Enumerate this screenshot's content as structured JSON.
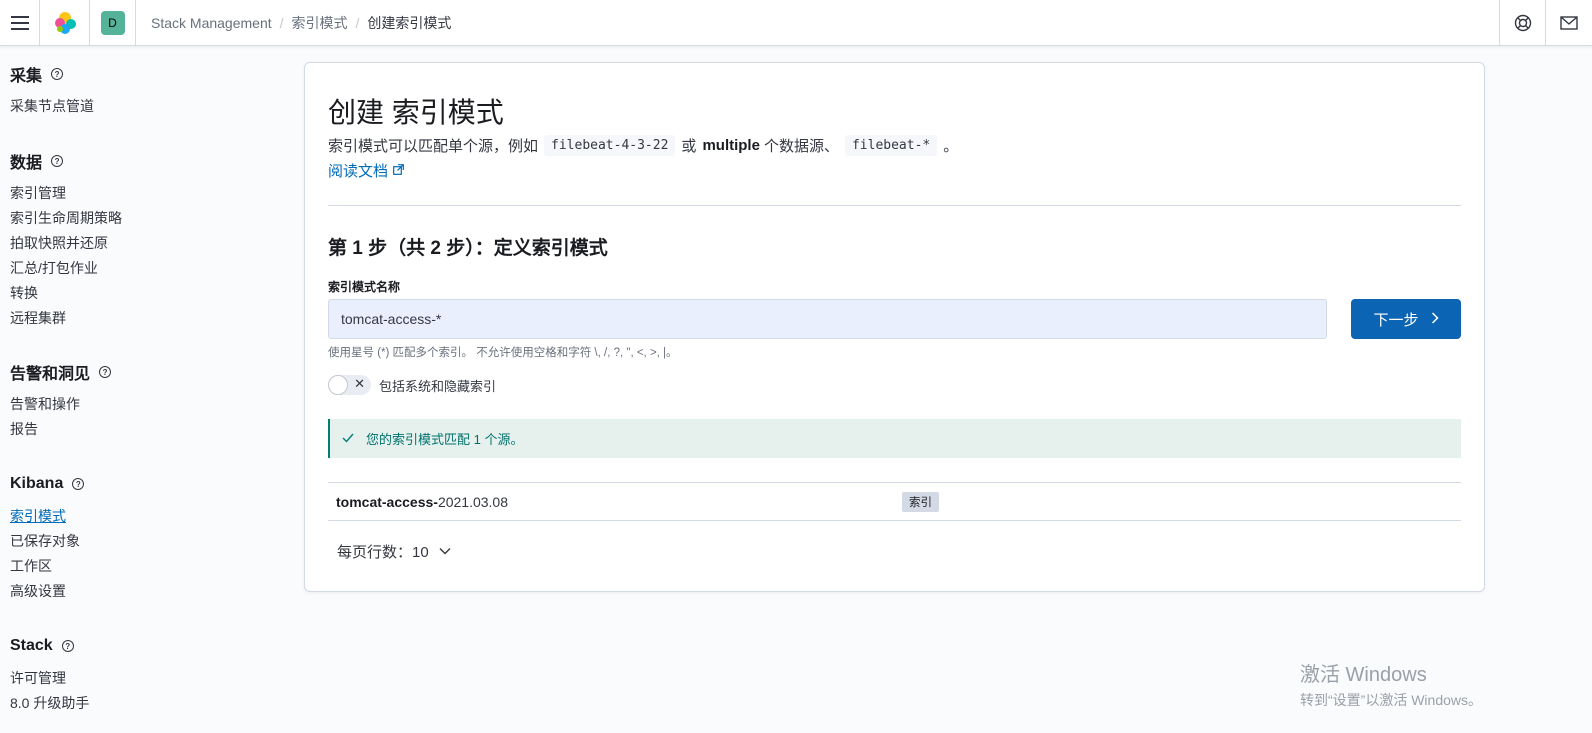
{
  "header": {
    "space_initial": "D",
    "breadcrumbs": [
      "Stack Management",
      "索引模式",
      "创建索引模式"
    ]
  },
  "sidebar": {
    "groups": [
      {
        "title": "采集",
        "items": [
          "采集节点管道"
        ]
      },
      {
        "title": "数据",
        "items": [
          "索引管理",
          "索引生命周期策略",
          "拍取快照并还原",
          "汇总/打包作业",
          "转换",
          "远程集群"
        ]
      },
      {
        "title": "告警和洞见",
        "items": [
          "告警和操作",
          "报告"
        ]
      },
      {
        "title": "Kibana",
        "items": [
          "索引模式",
          "已保存对象",
          "工作区",
          "高级设置"
        ]
      },
      {
        "title": "Stack",
        "items": [
          "许可管理",
          "8.0 升级助手"
        ]
      }
    ],
    "active_item": "索引模式"
  },
  "main": {
    "title": "创建 索引模式",
    "desc_part1": "索引模式可以匹配单个源，例如",
    "code1": "filebeat-4-3-22",
    "desc_part2": "或",
    "desc_bold": "multiple",
    "desc_part3": "个数据源、",
    "code2": "filebeat-*",
    "desc_part4": "。",
    "doc_link": "阅读文档",
    "step_title": "第 1 步（共 2 步）：定义索引模式",
    "field_label": "索引模式名称",
    "field_value": "tomcat-access-*",
    "next_button": "下一步",
    "help_text": "使用星号 (*) 匹配多个索引。 不允许使用空格和字符 \\, /, ?, \", <, >, |。",
    "toggle_label": "包括系统和隐藏索引",
    "callout_text": "您的索引模式匹配 1 个源。",
    "match_row": {
      "name_bold": "tomcat-access-",
      "name_rest": "2021.03.08",
      "badge": "索引"
    },
    "rows_per_page": "每页行数：10"
  },
  "watermark": {
    "line1": "激活 Windows",
    "line2": "转到“设置”以激活 Windows。"
  }
}
